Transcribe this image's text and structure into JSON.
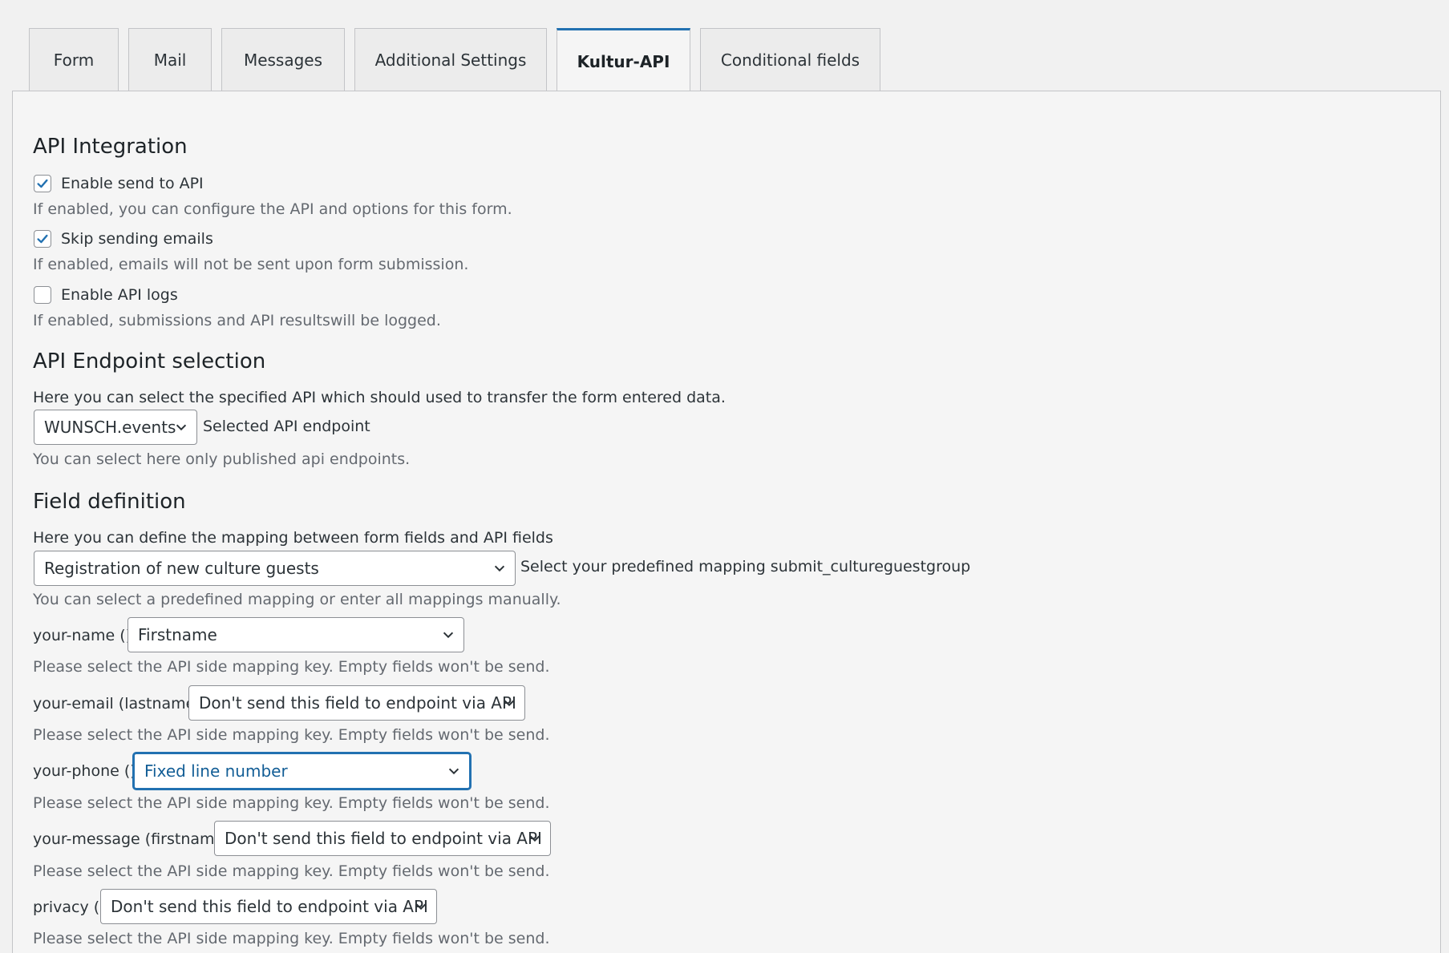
{
  "tabs": [
    {
      "label": "Form"
    },
    {
      "label": "Mail"
    },
    {
      "label": "Messages"
    },
    {
      "label": "Additional Settings"
    },
    {
      "label": "Kultur-API",
      "active": true
    },
    {
      "label": "Conditional fields"
    }
  ],
  "api_integration": {
    "heading": "API Integration",
    "enable_send": {
      "label": "Enable send to API",
      "checked": true,
      "desc": "If enabled, you can configure the API and options for this form."
    },
    "skip_emails": {
      "label": "Skip sending emails",
      "checked": true,
      "desc": "If enabled, emails will not be sent upon form submission."
    },
    "enable_logs": {
      "label": "Enable API logs",
      "checked": false,
      "desc": "If enabled, submissions and API resultswill be logged."
    }
  },
  "endpoint": {
    "heading": "API Endpoint selection",
    "intro": "Here you can select the specified API which should used to transfer the form entered data.",
    "select_value": "WUNSCH.events",
    "select_label": "Selected API endpoint",
    "desc": "You can select here only published api endpoints."
  },
  "field_definition": {
    "heading": "Field definition",
    "intro": "Here you can define the mapping between form fields and API fields",
    "mapping_value": "Registration of new culture guests",
    "mapping_label": "Select your predefined mapping submit_cultureguestgroup",
    "mapping_desc": "You can select a predefined mapping or enter all mappings manually.",
    "fields": [
      {
        "label": "your-name ()",
        "value": "Firstname",
        "desc": "Please select the API side mapping key. Empty fields won't be send."
      },
      {
        "label": "your-email (lastname)",
        "value": "Don't send this field to endpoint via API",
        "desc": "Please select the API side mapping key. Empty fields won't be send."
      },
      {
        "label": "your-phone ()",
        "value": "Fixed line number",
        "desc": "Please select the API side mapping key. Empty fields won't be send."
      },
      {
        "label": "your-message (firstname)",
        "value": "Don't send this field to endpoint via API",
        "desc": "Please select the API side mapping key. Empty fields won't be send."
      },
      {
        "label": "privacy ()",
        "value": "Don't send this field to endpoint via API",
        "desc": "Please select the API side mapping key. Empty fields won't be send."
      }
    ]
  },
  "colors": {
    "accent": "#2271b1",
    "page_bg": "#f5f5f5",
    "muted_text": "#646970"
  }
}
